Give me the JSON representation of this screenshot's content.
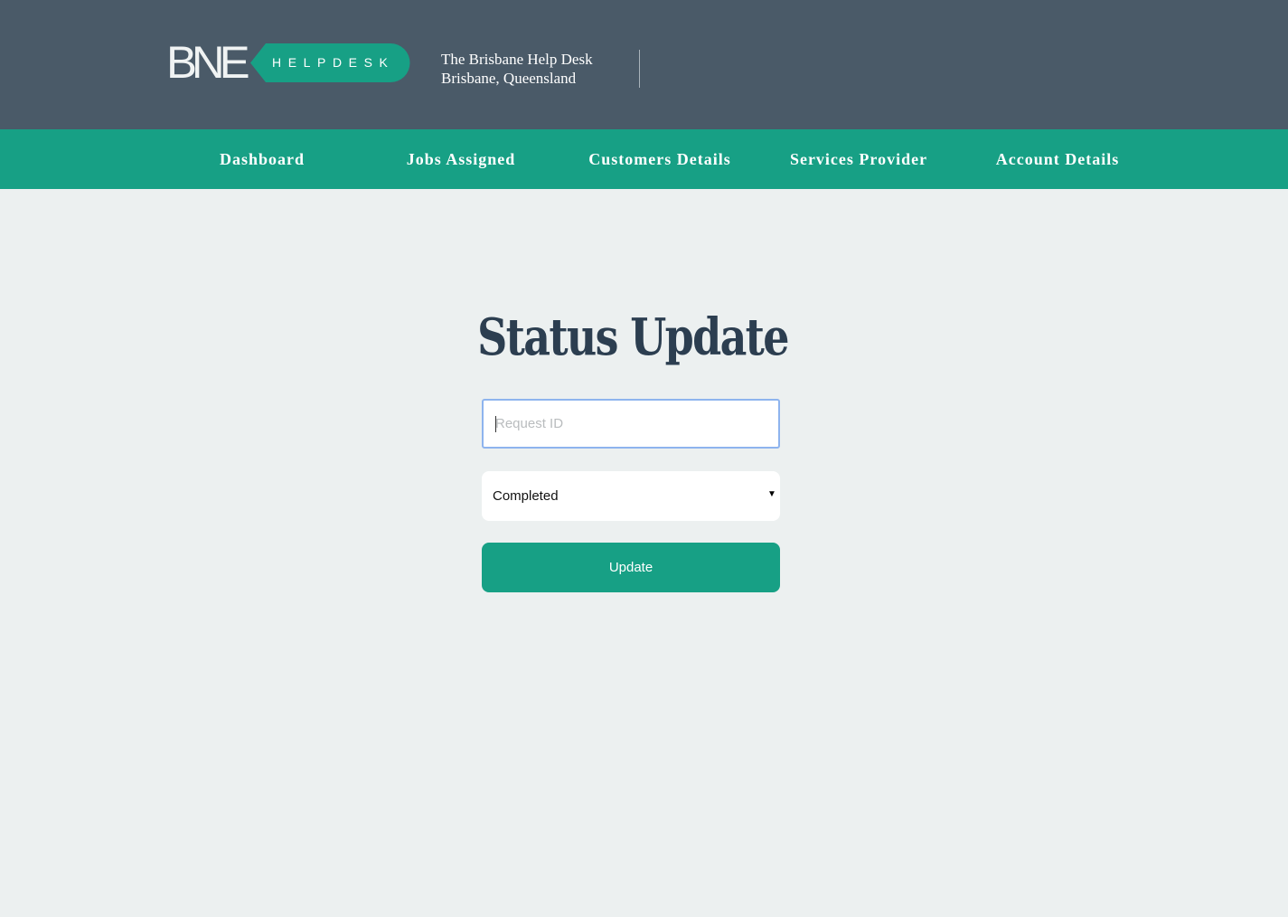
{
  "header": {
    "logo": {
      "bne": "BNE",
      "tag": "HELPDESK",
      "tag_color": "#17a085"
    },
    "tagline_line1": "The Brisbane Help Desk",
    "tagline_line2": "Brisbane, Queensland",
    "background": "#4a5a68"
  },
  "nav": {
    "background": "#17a085",
    "items": [
      {
        "label": "Dashboard"
      },
      {
        "label": "Jobs Assigned"
      },
      {
        "label": "Customers Details"
      },
      {
        "label": "Services Provider"
      },
      {
        "label": "Account Details"
      }
    ]
  },
  "main": {
    "title": "Status Update",
    "request_id": {
      "value": "",
      "placeholder": "Request ID"
    },
    "status_select": {
      "selected": "Completed",
      "arrow": "▼"
    },
    "update_button": "Update"
  }
}
